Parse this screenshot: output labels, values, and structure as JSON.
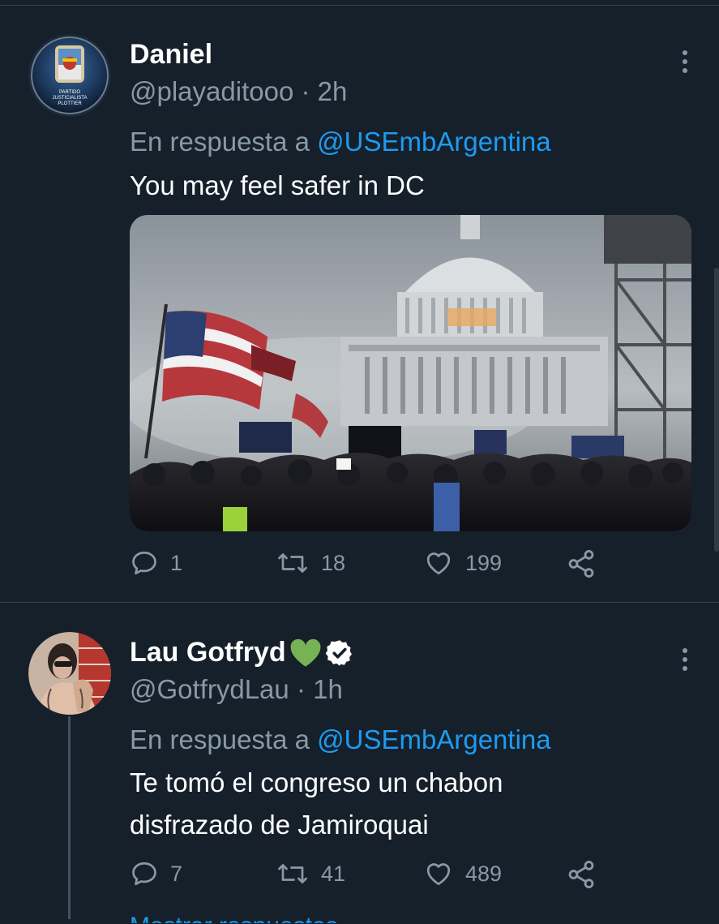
{
  "tweets": [
    {
      "name": "Daniel",
      "handle": "@playaditooo",
      "time_sep": "·",
      "time": "2h",
      "reply_prefix": "En respuesta a",
      "reply_to": "@USEmbArgentina",
      "text": "You may feel safer in DC",
      "avatar_text_line1": "PARTIDO",
      "avatar_text_line2": "JUSTICIALISTA",
      "avatar_text_line3": "PLOTTIER",
      "has_media": true,
      "stats": {
        "replies": "1",
        "retweets": "18",
        "likes": "199"
      }
    },
    {
      "name": "Lau Gotfryd",
      "verified": true,
      "handle": "@GotfrydLau",
      "time_sep": "·",
      "time": "1h",
      "reply_prefix": "En respuesta a",
      "reply_to": "@USEmbArgentina",
      "text_line1": "Te tomó el congreso un chabon",
      "text_line2": "disfrazado de Jamiroquai",
      "stats": {
        "replies": "7",
        "retweets": "41",
        "likes": "489"
      }
    }
  ],
  "footer": {
    "more_replies_label": "Mostrar respuestas"
  },
  "icons": {
    "reply": "comment-bubble-icon",
    "retweet": "retweet-arrows-icon",
    "like": "heart-outline-icon",
    "share": "share-nodes-icon",
    "more": "vertical-ellipsis-icon",
    "verified": "verified-badge-icon",
    "emoji": "green-heart-emoji-icon"
  },
  "colors": {
    "background": "#15202b",
    "accent": "#1d9bf0",
    "secondary_text": "#8899a6",
    "divider": "#38444d",
    "green_heart": "#77b255"
  }
}
